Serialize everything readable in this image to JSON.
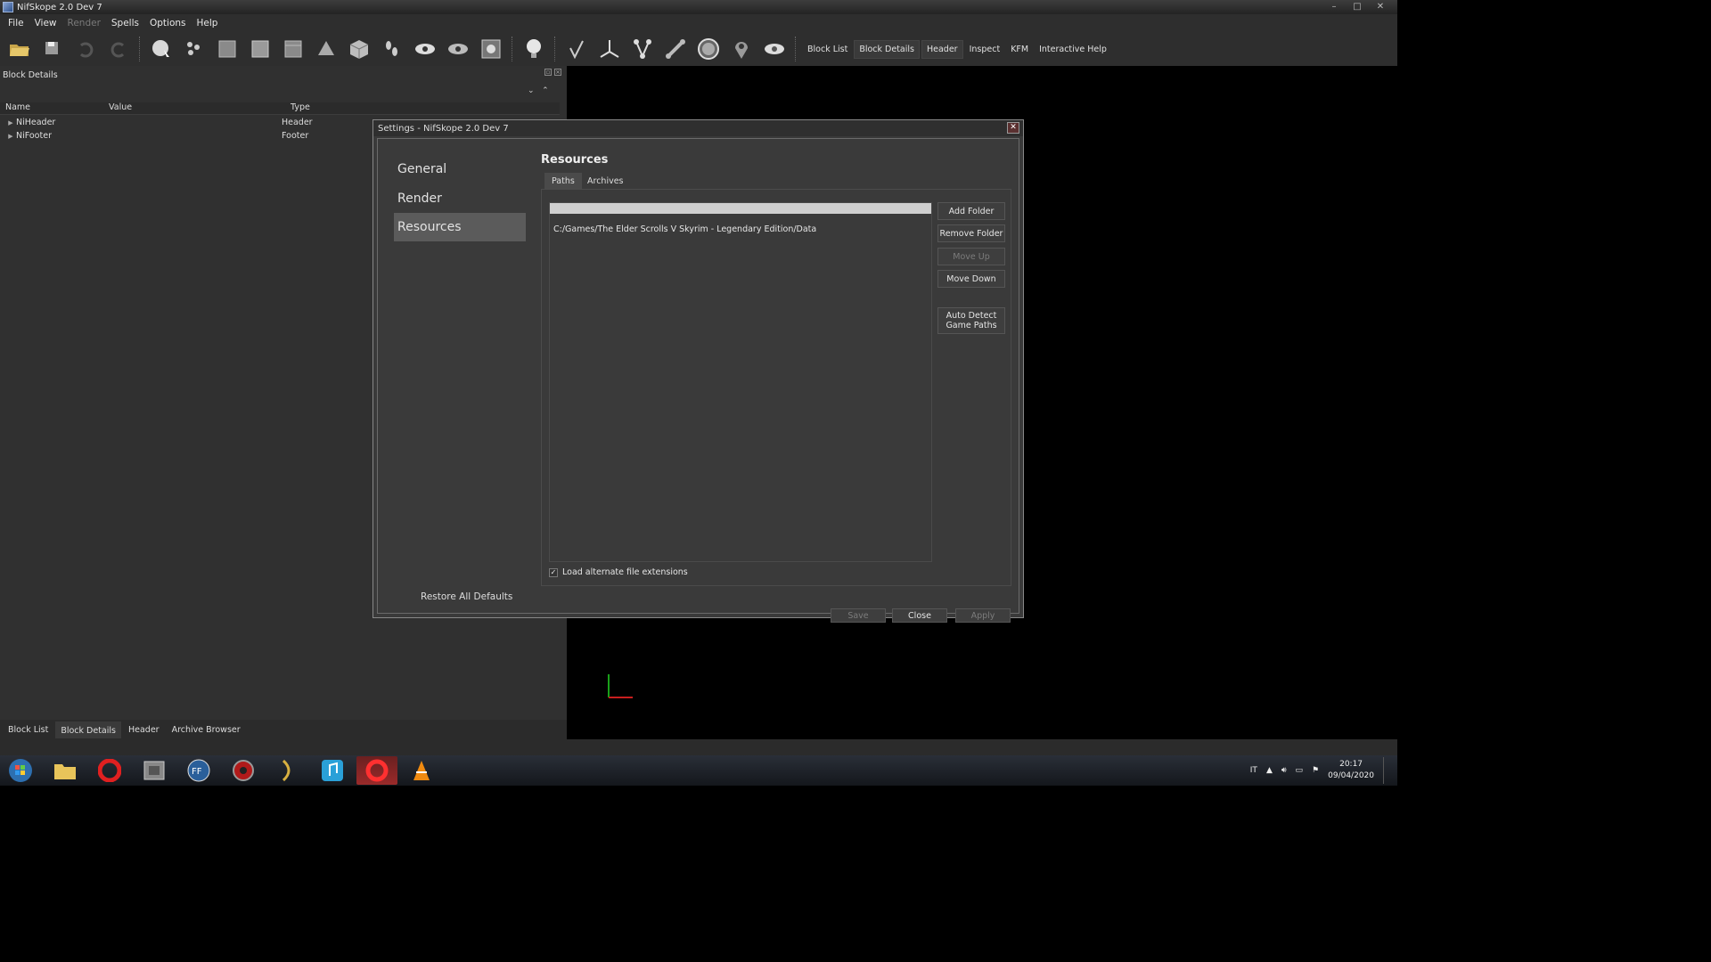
{
  "window": {
    "title": "NifSkope 2.0 Dev 7"
  },
  "menu": [
    "File",
    "View",
    "Render",
    "Spells",
    "Options",
    "Help"
  ],
  "menu_disabled": [
    "Render"
  ],
  "toolbar": {
    "tabs": [
      "Block List",
      "Block Details",
      "Header",
      "Inspect",
      "KFM",
      "Interactive Help"
    ],
    "active_tab": "Block Details"
  },
  "dock": {
    "title": "Block Details",
    "columns": [
      "Name",
      "Value",
      "Type"
    ],
    "rows": [
      {
        "name": "NiHeader",
        "value": "",
        "type": "Header"
      },
      {
        "name": "NiFooter",
        "value": "",
        "type": "Footer"
      }
    ],
    "bottom_tabs": [
      "Block List",
      "Block Details",
      "Header",
      "Archive Browser"
    ],
    "active_bottom_tab": "Block Details"
  },
  "dialog": {
    "title": "Settings - NifSkope 2.0 Dev 7",
    "nav": [
      "General",
      "Render",
      "Resources"
    ],
    "active_nav": "Resources",
    "section_title": "Resources",
    "tabs": [
      "Paths",
      "Archives"
    ],
    "active_tab": "Paths",
    "paths": [
      "C:/Games/The Elder Scrolls V Skyrim - Legendary Edition/Data"
    ],
    "buttons": {
      "add_folder": "Add Folder",
      "remove_folder": "Remove Folder",
      "move_up": "Move Up",
      "move_down": "Move Down",
      "auto_detect": "Auto Detect Game Paths"
    },
    "checkbox": {
      "label": "Load alternate file extensions",
      "checked": true
    },
    "restore_defaults": "Restore All Defaults",
    "footer_buttons": {
      "save": "Save",
      "close": "Close",
      "apply": "Apply"
    }
  },
  "taskbar": {
    "language": "IT",
    "time": "20:17",
    "date": "09/04/2020"
  }
}
